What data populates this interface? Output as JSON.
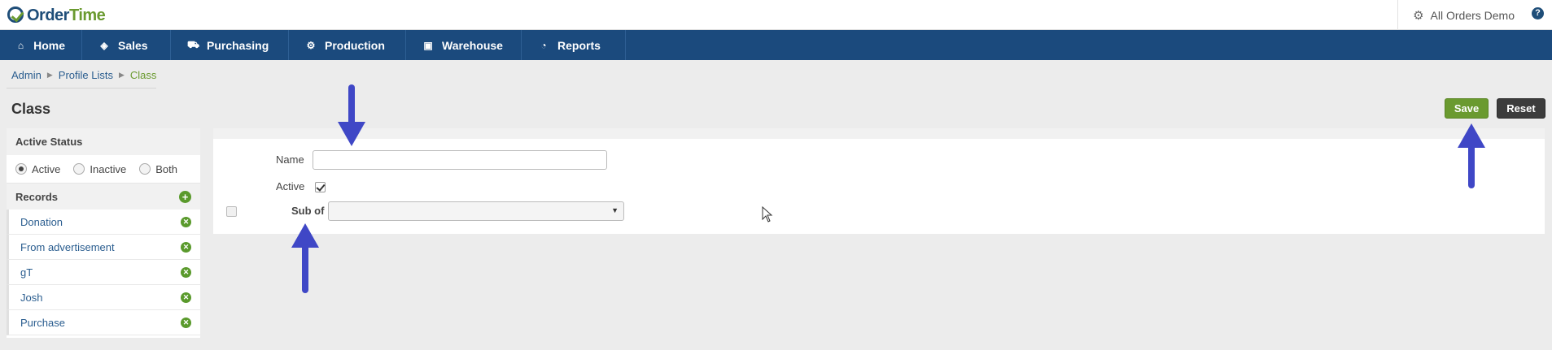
{
  "header": {
    "logo_text": "OrderTime",
    "account_label": "All Orders Demo",
    "help_label": "?"
  },
  "nav": {
    "items": [
      {
        "label": "Home",
        "icon": "home-icon"
      },
      {
        "label": "Sales",
        "icon": "tag-icon"
      },
      {
        "label": "Purchasing",
        "icon": "cart-icon"
      },
      {
        "label": "Production",
        "icon": "gears-icon"
      },
      {
        "label": "Warehouse",
        "icon": "box-icon"
      },
      {
        "label": "Reports",
        "icon": "pie-chart-icon"
      }
    ]
  },
  "breadcrumb": {
    "items": [
      "Admin",
      "Profile Lists"
    ],
    "current": "Class"
  },
  "page": {
    "title": "Class",
    "save_label": "Save",
    "reset_label": "Reset"
  },
  "sidebar": {
    "status_title": "Active Status",
    "status_options": [
      "Active",
      "Inactive",
      "Both"
    ],
    "status_selected": "Active",
    "records_title": "Records",
    "records": [
      "Donation",
      "From advertisement",
      "gT",
      "Josh",
      "Purchase"
    ]
  },
  "form": {
    "name_label": "Name",
    "name_value": "",
    "active_label": "Active",
    "active_checked": true,
    "sub_of_label": "Sub of",
    "sub_of_value": ""
  },
  "colors": {
    "nav_bg": "#1b4a7d",
    "save": "#6a9a2f",
    "reset": "#3c3c3c",
    "annotation_arrow": "#3f47c6"
  }
}
